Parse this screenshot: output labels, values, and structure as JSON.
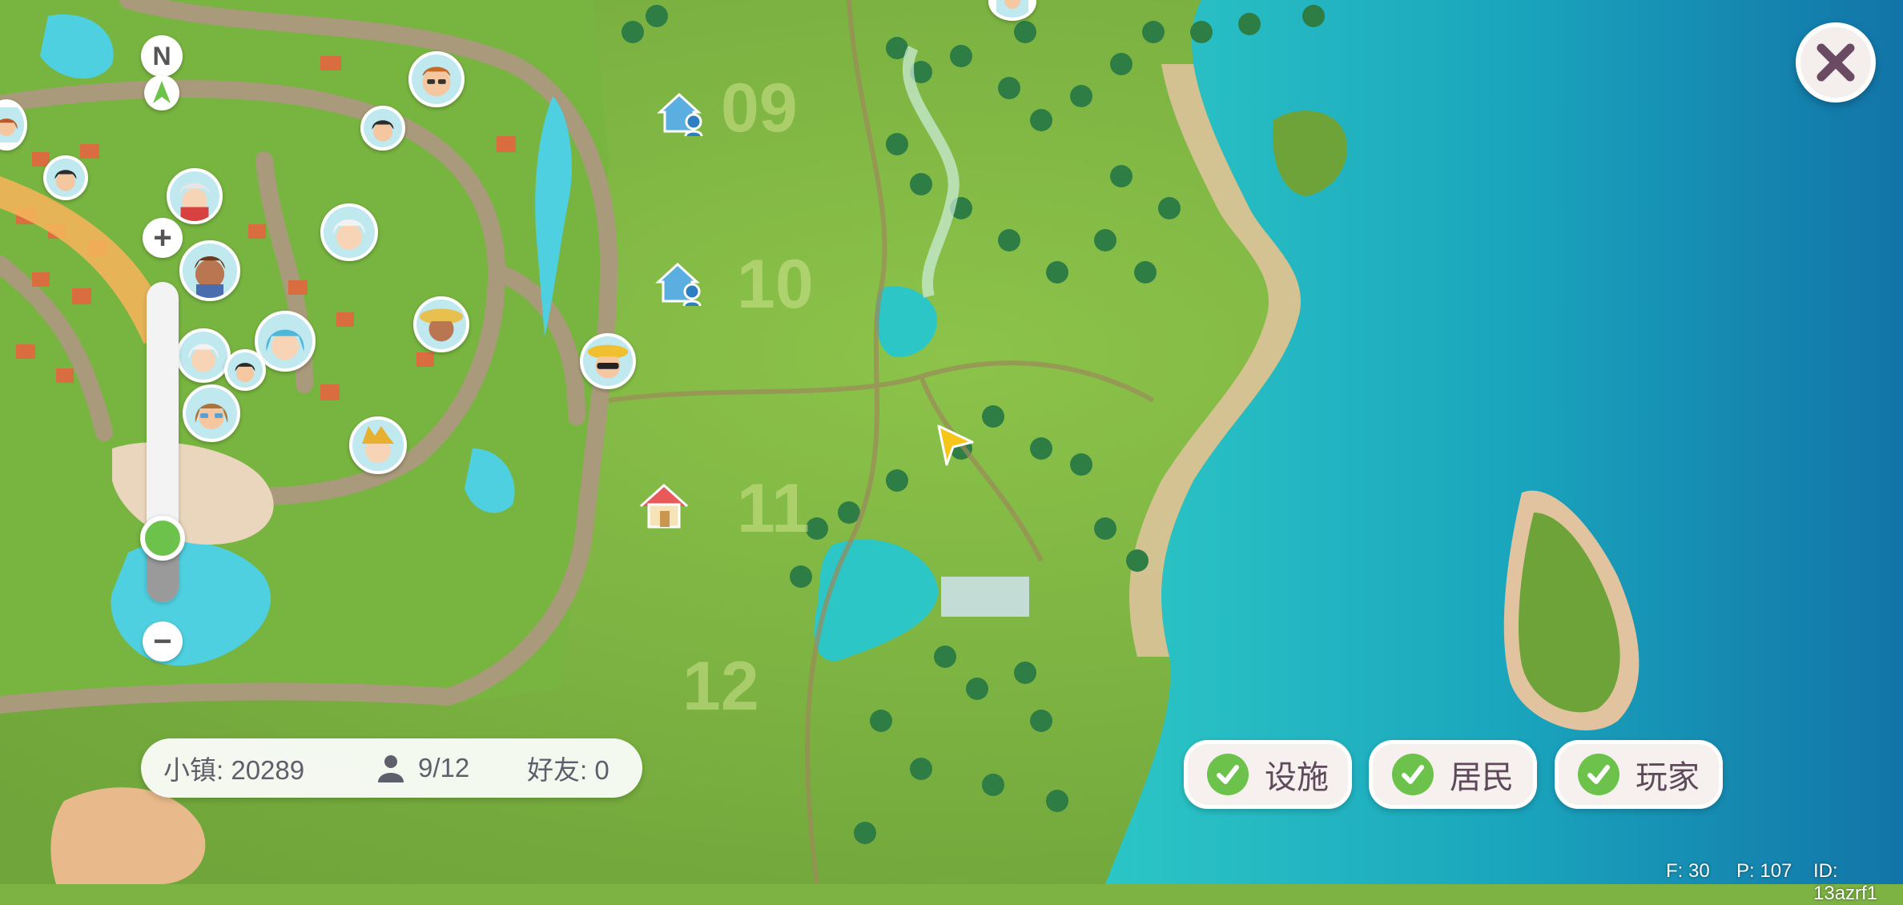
{
  "window": {
    "close_icon": "close-icon"
  },
  "compass": {
    "north_label": "N"
  },
  "zoom": {
    "plus_label": "+",
    "minus_label": "−",
    "level": 0.2
  },
  "plots": [
    {
      "label": "09"
    },
    {
      "label": "10"
    },
    {
      "label": "11"
    },
    {
      "label": "12"
    }
  ],
  "info_bar": {
    "town": "小镇: 20289",
    "population": "9/12",
    "friends": "好友: 0",
    "population_icon": "person-icon"
  },
  "filters": {
    "facilities": "设施",
    "residents": "居民",
    "players": "玩家"
  },
  "debug": {
    "f": "F: 30",
    "p": "P: 107",
    "id": "ID: 13azrf1"
  },
  "colors": {
    "grass": "#7cb342",
    "sea": "#1ba5b5",
    "deep_sea": "#1578a8",
    "road": "#a89a7a",
    "check_green": "#6cc24a",
    "home_red": "#e85a5a",
    "resident_home_blue": "#5aaee0",
    "player_marker": "#f5c518"
  }
}
